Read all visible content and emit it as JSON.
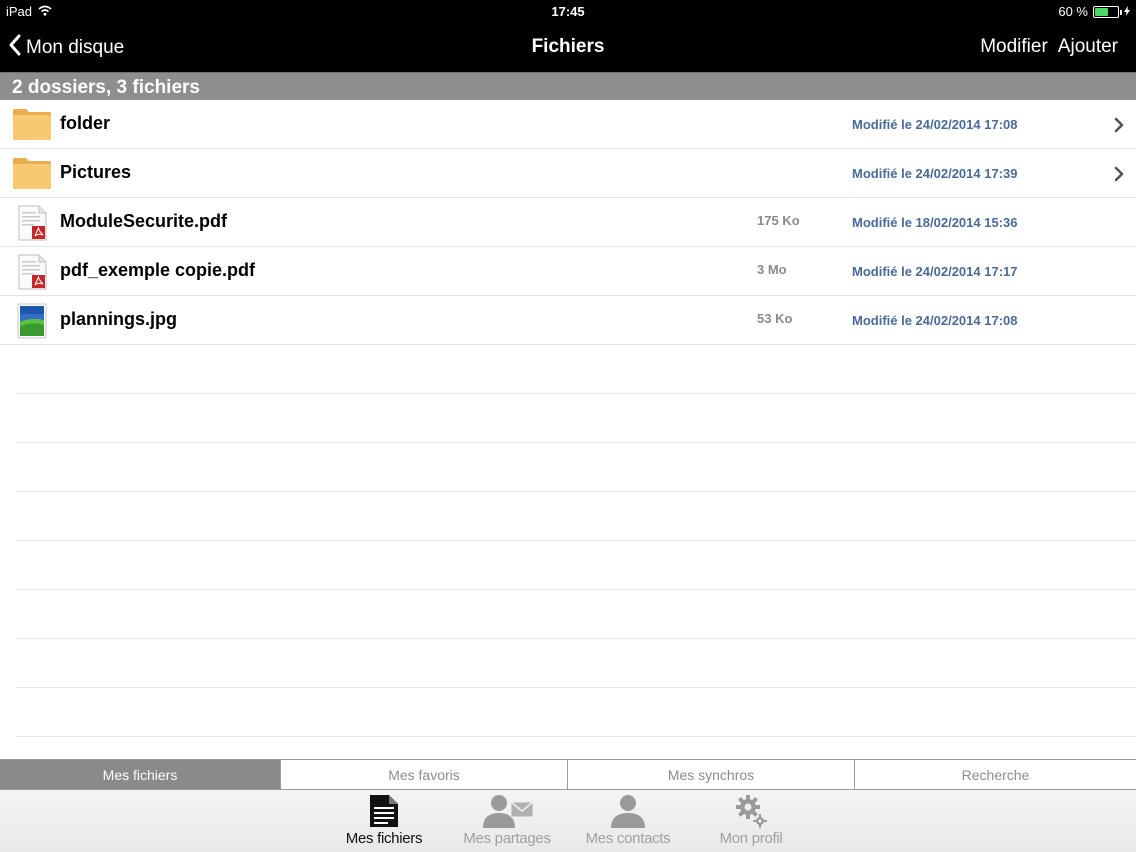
{
  "status": {
    "device": "iPad",
    "time": "17:45",
    "battery": "60 %",
    "battery_level": 0.6,
    "battery_color": "#4cd964"
  },
  "nav": {
    "back_label": "Mon disque",
    "title": "Fichiers",
    "edit_label": "Modifier",
    "add_label": "Ajouter"
  },
  "section": {
    "summary": "2 dossiers, 3 fichiers"
  },
  "files": [
    {
      "name": "folder",
      "type": "folder",
      "size": "",
      "modified": "Modifié le 24/02/2014 17:08"
    },
    {
      "name": "Pictures",
      "type": "folder",
      "size": "",
      "modified": "Modifié le 24/02/2014 17:39"
    },
    {
      "name": "ModuleSecurite.pdf",
      "type": "pdf",
      "size": "175 Ko",
      "modified": "Modifié le 18/02/2014 15:36"
    },
    {
      "name": "pdf_exemple copie.pdf",
      "type": "pdf",
      "size": "3 Mo",
      "modified": "Modifié le 24/02/2014 17:17"
    },
    {
      "name": "plannings.jpg",
      "type": "image",
      "size": "53 Ko",
      "modified": "Modifié le 24/02/2014 17:08"
    }
  ],
  "segments": [
    {
      "label": "Mes fichiers",
      "active": true
    },
    {
      "label": "Mes favoris",
      "active": false
    },
    {
      "label": "Mes synchros",
      "active": false
    },
    {
      "label": "Recherche",
      "active": false
    }
  ],
  "tabs": [
    {
      "label": "Mes fichiers",
      "icon": "document-icon",
      "active": true
    },
    {
      "label": "Mes partages",
      "icon": "share-person-icon",
      "active": false
    },
    {
      "label": "Mes contacts",
      "icon": "person-icon",
      "active": false
    },
    {
      "label": "Mon profil",
      "icon": "gear-icon",
      "active": false
    }
  ],
  "colors": {
    "date_text": "#4a6b98",
    "section_bg": "#8e8e8e",
    "folder": "#f5c46a"
  }
}
